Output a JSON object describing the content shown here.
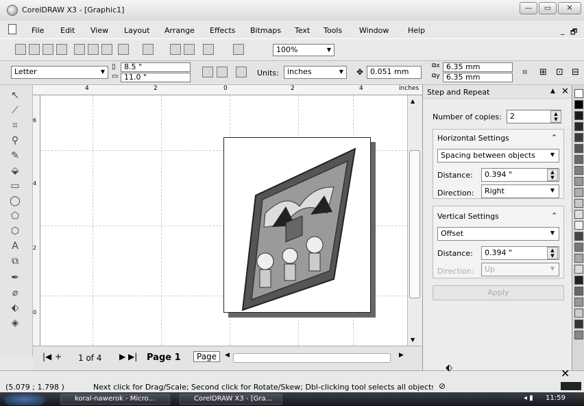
{
  "window": {
    "title": "CorelDRAW X3 - [Graphic1]",
    "controls": [
      "—",
      "▭",
      "✕"
    ],
    "doc_controls": [
      "_",
      "🗗"
    ]
  },
  "menu": [
    "File",
    "Edit",
    "View",
    "Layout",
    "Arrange",
    "Effects",
    "Bitmaps",
    "Text",
    "Tools",
    "Window",
    "Help"
  ],
  "toolbar": {
    "zoom": "100%"
  },
  "propbar": {
    "paper": "Letter",
    "width": "8.5 \"",
    "height": "11.0 \"",
    "units_label": "Units:",
    "units": "inches",
    "nudge": "0.051 mm",
    "dup_x": "6.35 mm",
    "dup_y": "6.35 mm"
  },
  "ruler": {
    "unit": "inches",
    "ticks": [
      "4",
      "2",
      "0",
      "2",
      "4"
    ],
    "vticks": [
      "6",
      "4",
      "2",
      "0"
    ]
  },
  "pages": {
    "counter": "1 of 4",
    "active_tab": "Page 1",
    "next_tab": "Page"
  },
  "docker": {
    "title": "Step and Repeat",
    "copies_label": "Number of copies:",
    "copies": "2",
    "horizontal": {
      "header": "Horizontal Settings",
      "mode": "Spacing between objects",
      "distance_label": "Distance:",
      "distance": "0.394 \"",
      "direction_label": "Direction:",
      "direction": "Right"
    },
    "vertical": {
      "header": "Vertical Settings",
      "mode": "Offset",
      "distance_label": "Distance:",
      "distance": "0.394 \"",
      "direction_label": "Direction:",
      "direction": "Up"
    },
    "apply": "Apply"
  },
  "status": {
    "coords": "(5.079 ; 1.798 )",
    "message": "Next click for Drag/Scale; Second click for Rotate/Skew; Dbl-clicking tool selects all objects; Shift..."
  },
  "taskbar": {
    "items": [
      "koral-nawerok - Micro...",
      "CorelDRAW X3 - [Gra..."
    ],
    "clock": "11:59"
  },
  "palette_colors": [
    "#ffffff",
    "#000000",
    "#1a1a1a",
    "#2a2a2a",
    "#3d3d3d",
    "#555555",
    "#6a6a6a",
    "#808080",
    "#999999",
    "#b0b0b0",
    "#c8c8c8",
    "#e0e0e0",
    "#f0f0f0",
    "#444444",
    "#777777",
    "#aaaaaa",
    "#dddddd",
    "#222222",
    "#666666",
    "#999999",
    "#cccccc",
    "#333333",
    "#888888"
  ]
}
